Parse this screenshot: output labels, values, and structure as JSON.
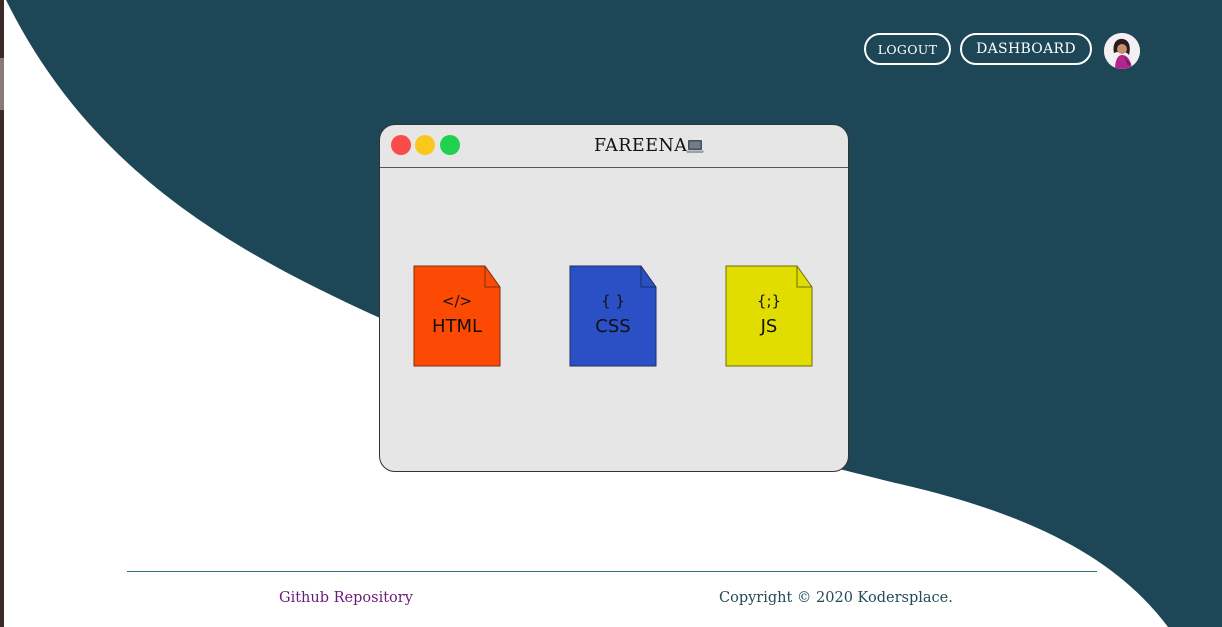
{
  "header": {
    "logout_label": "LOGOUT",
    "dashboard_label": "DASHBOARD",
    "avatar_icon": "profile-avatar-icon"
  },
  "window": {
    "title": "FAREENA",
    "title_icon": "laptop-icon",
    "controls": [
      "close",
      "minimize",
      "maximize"
    ],
    "files": [
      {
        "glyph": "</>",
        "label": "HTML",
        "color": "#fc4a04"
      },
      {
        "glyph": "{ }",
        "label": "CSS",
        "color": "#2b4fc4"
      },
      {
        "glyph": "{;}",
        "label": "JS",
        "color": "#e2dd00"
      }
    ]
  },
  "footer": {
    "github_link": "Github Repository",
    "copyright": "Copyright © 2020 Kodersplace."
  },
  "colors": {
    "background_dark": "#1d4757",
    "background_light": "#ffffff",
    "window_bg": "#e6e6e6",
    "link": "#6a1b7a"
  }
}
